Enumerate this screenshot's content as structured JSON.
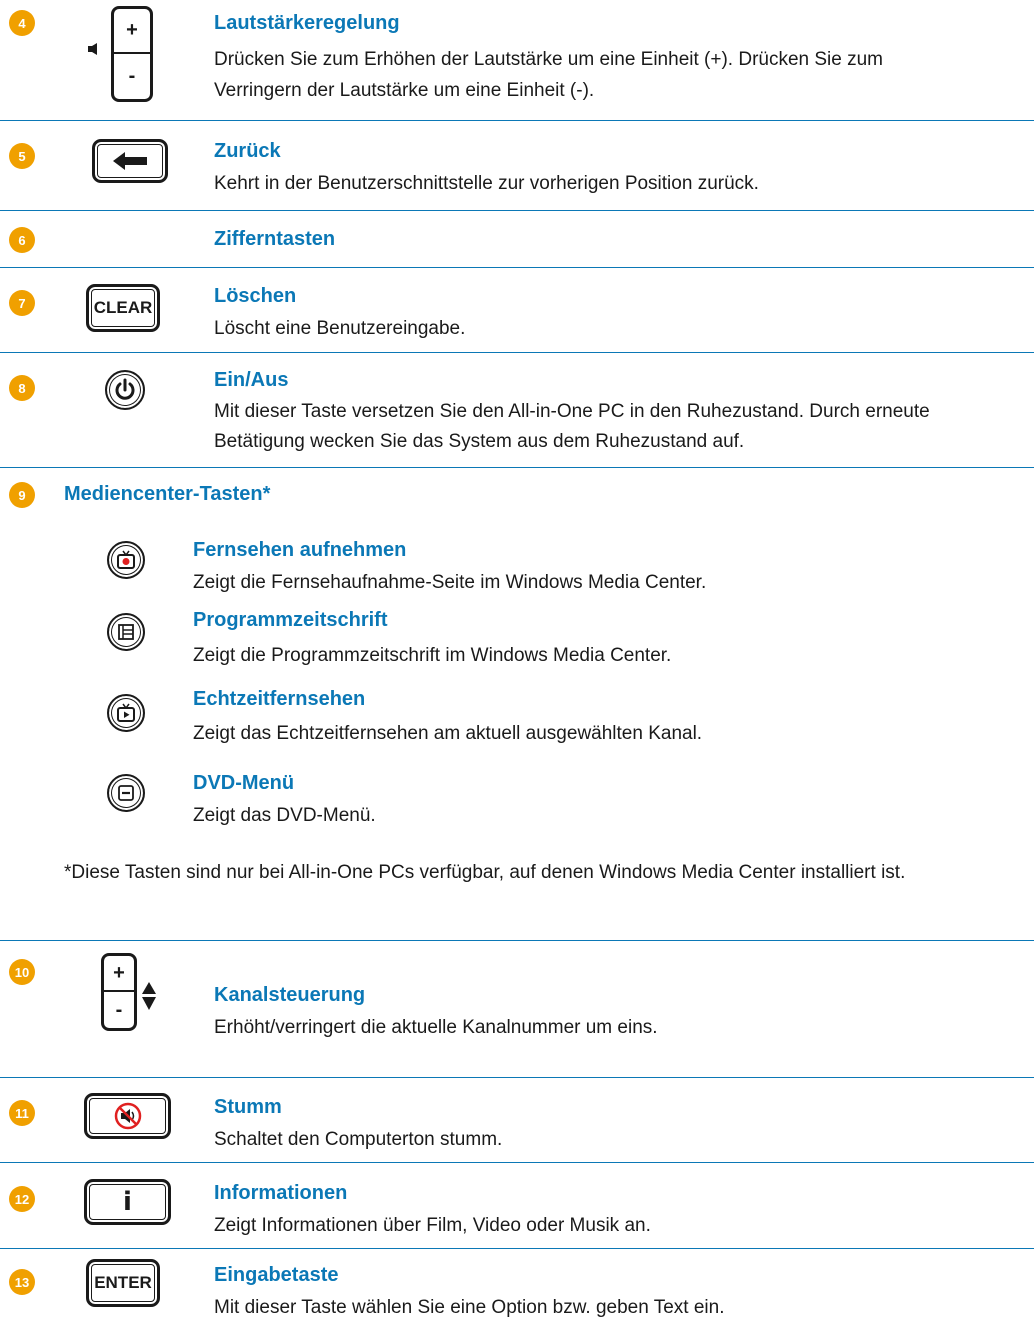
{
  "colors": {
    "accent": "#0b78b6",
    "badge": "#f0a000",
    "text": "#1a1a1a"
  },
  "entries": [
    {
      "num": "4",
      "title": "Lautstärkeregelung",
      "lines": [
        "Drücken Sie zum Erhöhen der Lautstärke um eine Einheit (+). Drücken Sie zum",
        "Verringern der Lautstärke um eine Einheit (-)."
      ],
      "icon": "volume-rocker-icon",
      "plus": "+",
      "minus": "-"
    },
    {
      "num": "5",
      "title": "Zurück",
      "lines": [
        "Kehrt in der Benutzerschnittstelle zur vorherigen Position zurück."
      ],
      "icon": "back-arrow-icon"
    },
    {
      "num": "6",
      "title": "Zifferntasten"
    },
    {
      "num": "7",
      "title": "Löschen",
      "lines": [
        "Löscht eine Benutzereingabe."
      ],
      "button_text": "CLEAR"
    },
    {
      "num": "8",
      "title": "Ein/Aus",
      "lines": [
        "Mit dieser Taste versetzen Sie den All-in-One PC in den Ruhezustand. Durch erneute",
        "Betätigung wecken Sie das System aus dem Ruhezustand auf."
      ],
      "icon": "power-icon"
    }
  ],
  "media": {
    "num": "9",
    "heading": "Mediencenter-Tasten*",
    "items": [
      {
        "title": "Fernsehen aufnehmen",
        "desc": "Zeigt die Fernsehaufnahme-Seite im Windows Media Center.",
        "icon": "record-tv-icon"
      },
      {
        "title": "Programmzeitschrift",
        "desc": "Zeigt die Programmzeitschrift im Windows Media Center.",
        "icon": "guide-icon"
      },
      {
        "title": "Echtzeitfernsehen",
        "desc": "Zeigt das Echtzeitfernsehen am aktuell ausgewählten Kanal.",
        "icon": "live-tv-icon"
      },
      {
        "title": "DVD-Menü",
        "desc": "Zeigt das DVD-Menü.",
        "icon": "dvd-menu-icon"
      }
    ],
    "footnote": "*Diese Tasten sind nur bei All-in-One PCs verfügbar, auf denen Windows Media Center installiert ist."
  },
  "entries2": [
    {
      "num": "10",
      "title": "Kanalsteuerung",
      "lines": [
        "Erhöht/verringert die aktuelle Kanalnummer um eins."
      ],
      "icon": "channel-rocker-icon",
      "plus": "+",
      "minus": "-"
    },
    {
      "num": "11",
      "title": "Stumm",
      "lines": [
        "Schaltet den Computerton stumm."
      ],
      "icon": "mute-icon"
    },
    {
      "num": "12",
      "title": "Informationen",
      "lines": [
        "Zeigt Informationen über Film, Video oder Musik an."
      ],
      "icon": "info-icon",
      "button_text": "i"
    },
    {
      "num": "13",
      "title": "Eingabetaste",
      "lines": [
        "Mit dieser Taste wählen Sie eine Option bzw. geben Text ein."
      ],
      "button_text": "ENTER"
    }
  ]
}
